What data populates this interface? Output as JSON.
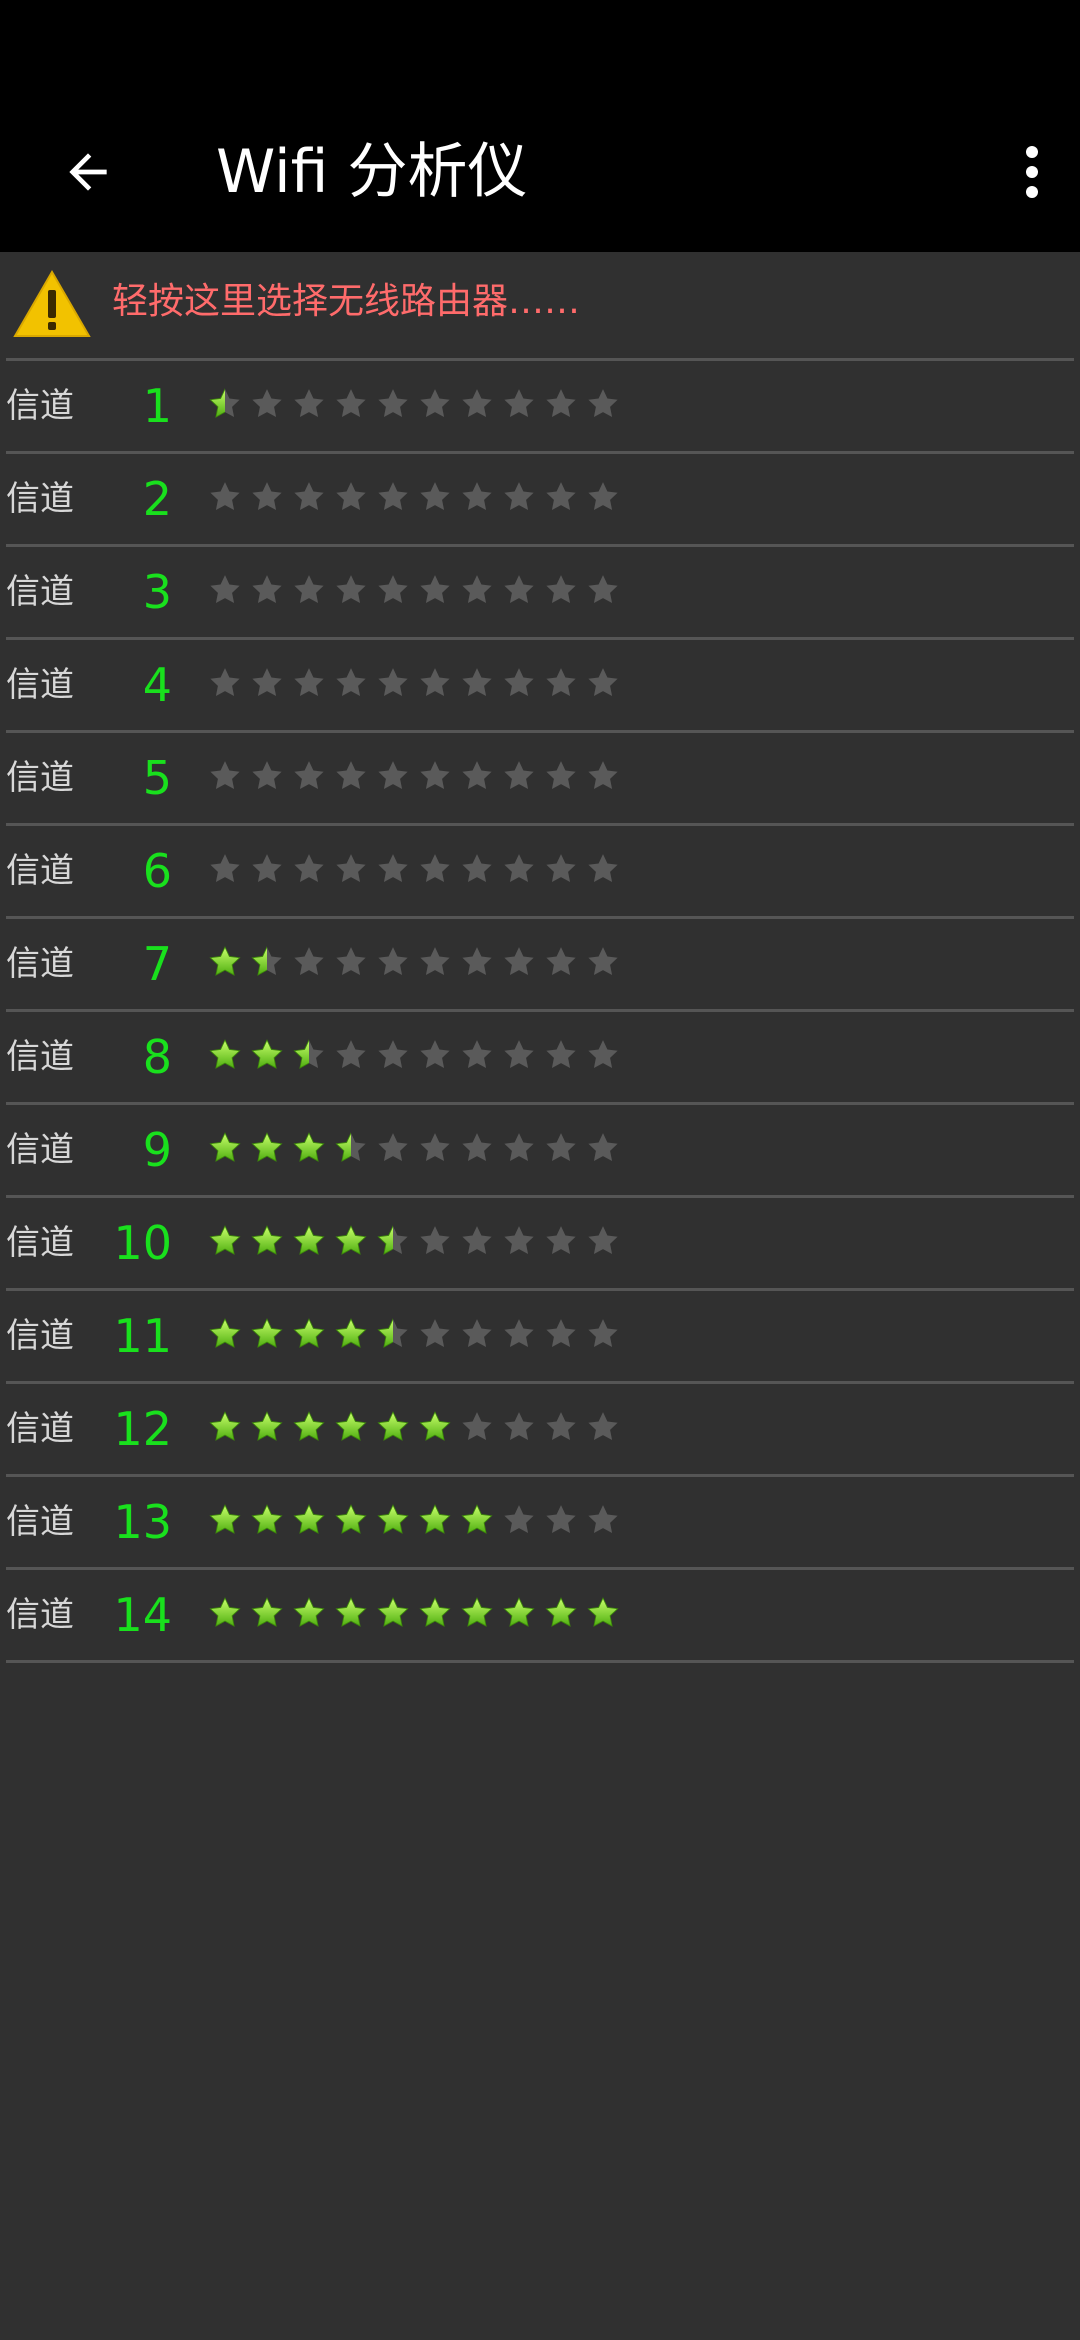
{
  "header": {
    "title": "Wifi 分析仪"
  },
  "warning": {
    "text": "轻按这里选择无线路由器……"
  },
  "channels": [
    {
      "label": "信道",
      "number": "1",
      "rating": 0.5
    },
    {
      "label": "信道",
      "number": "2",
      "rating": 0
    },
    {
      "label": "信道",
      "number": "3",
      "rating": 0
    },
    {
      "label": "信道",
      "number": "4",
      "rating": 0
    },
    {
      "label": "信道",
      "number": "5",
      "rating": 0
    },
    {
      "label": "信道",
      "number": "6",
      "rating": 0
    },
    {
      "label": "信道",
      "number": "7",
      "rating": 1.5
    },
    {
      "label": "信道",
      "number": "8",
      "rating": 2.5
    },
    {
      "label": "信道",
      "number": "9",
      "rating": 3.5
    },
    {
      "label": "信道",
      "number": "10",
      "rating": 4.5
    },
    {
      "label": "信道",
      "number": "11",
      "rating": 4.5
    },
    {
      "label": "信道",
      "number": "12",
      "rating": 6
    },
    {
      "label": "信道",
      "number": "13",
      "rating": 7
    },
    {
      "label": "信道",
      "number": "14",
      "rating": 10
    }
  ],
  "rating_max": 10,
  "colors": {
    "star_on": "#8ee83a",
    "star_off": "#5a5a5a",
    "number": "#19e01d",
    "warning_text": "#ff6b6b",
    "background": "#303030"
  },
  "icons": {
    "back": "arrow-back-icon",
    "menu": "more-vert-icon",
    "warning": "warning-icon",
    "star": "star-icon"
  }
}
